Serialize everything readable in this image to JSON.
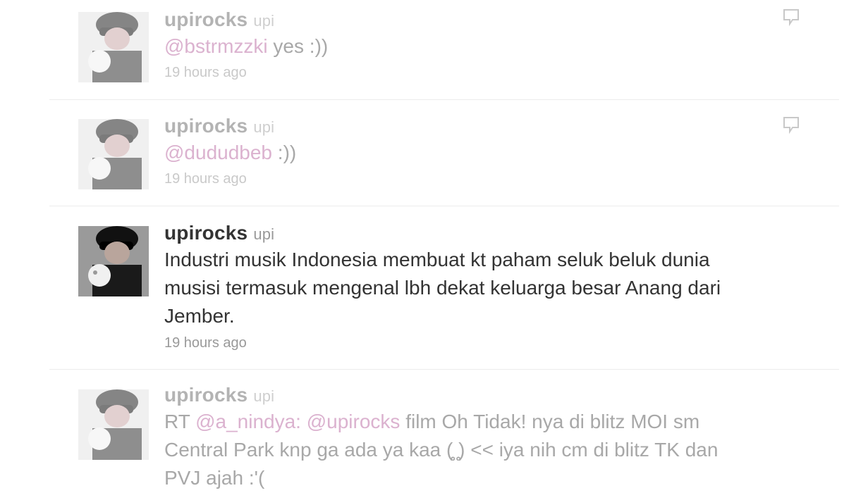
{
  "tweets": [
    {
      "handle": "upirocks",
      "name": "upi",
      "mention": "@bstrmzzki",
      "text": " yes :))",
      "time": "19 hours ago"
    },
    {
      "handle": "upirocks",
      "name": "upi",
      "mention": "@dududbeb",
      "text": " :))",
      "time": "19 hours ago"
    },
    {
      "handle": "upirocks",
      "name": "upi",
      "lines": [
        "Industri musik Indonesia membuat kt paham seluk beluk dunia",
        "musisi termasuk mengenal lbh dekat keluarga besar Anang dari",
        "Jember."
      ],
      "time": "19 hours ago"
    },
    {
      "handle": "upirocks",
      "name": "upi",
      "rt_prefix": "RT ",
      "mention1": "@a_nindya:",
      "mention2": "@upirocks",
      "line1_rest": " film Oh Tidak! nya di blitz MOI sm",
      "line2": "Central Park knp ga ada ya kaa (̥̥̥̥̥̥̥̥̥̥ ̥̥̥̥̥̥̥̥̥̥) << iya nih cm di blitz TK dan",
      "line3": "PVJ ajah :'("
    }
  ],
  "icons": {
    "reply": "reply-bubble-icon"
  },
  "colors": {
    "mention": "#d7a6c6",
    "text": "#333333",
    "muted": "#999999"
  }
}
